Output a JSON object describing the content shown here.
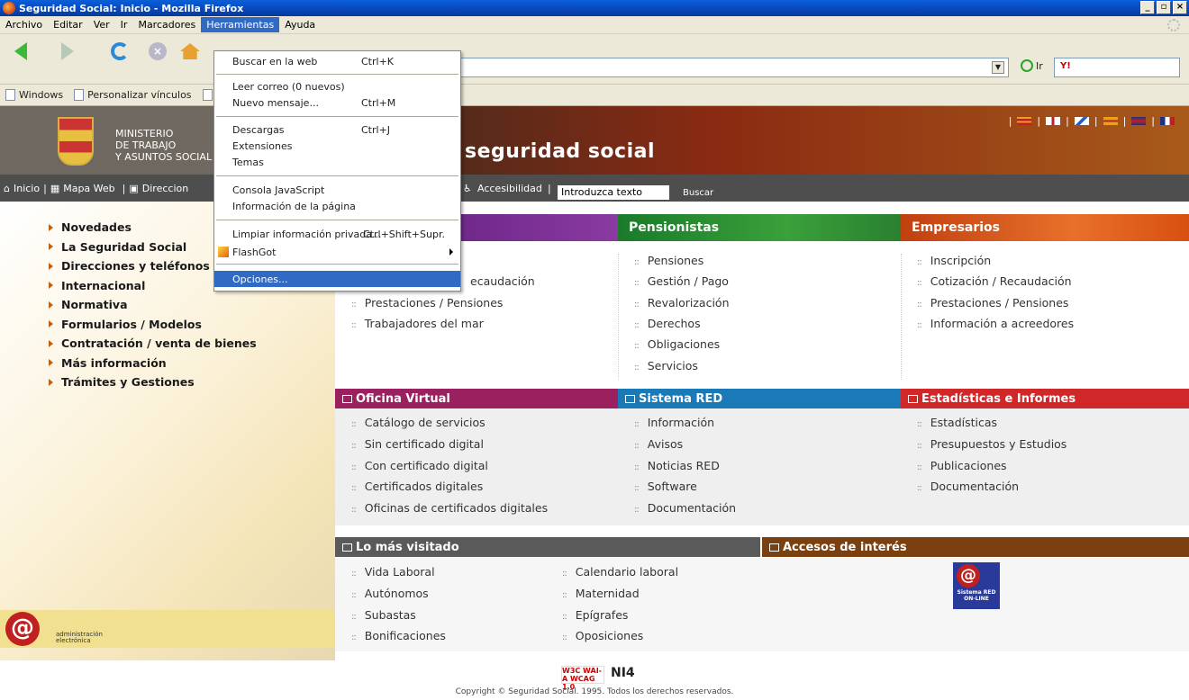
{
  "browser": {
    "title": "Seguridad Social: Inicio - Mozilla Firefox",
    "menu": [
      "Archivo",
      "Editar",
      "Ver",
      "Ir",
      "Marcadores",
      "Herramientas",
      "Ayuda"
    ],
    "go_label": "Ir",
    "search_text": "Y!",
    "bookmarks": [
      "Windows",
      "Personalizar vínculos"
    ],
    "tools_menu": [
      {
        "label": "Buscar en la web",
        "shortcut": "Ctrl+K"
      },
      {
        "label": "Leer correo (0 nuevos)",
        "shortcut": ""
      },
      {
        "label": "Nuevo mensaje...",
        "shortcut": "Ctrl+M"
      },
      {
        "label": "Descargas",
        "shortcut": "Ctrl+J"
      },
      {
        "label": "Extensiones",
        "shortcut": ""
      },
      {
        "label": "Temas",
        "shortcut": ""
      },
      {
        "label": "Consola JavaScript",
        "shortcut": ""
      },
      {
        "label": "Información de la página",
        "shortcut": ""
      },
      {
        "label": "Limpiar información privada...",
        "shortcut": "Ctrl+Shift+Supr."
      },
      {
        "label": "FlashGot",
        "shortcut": ""
      },
      {
        "label": "Opciones...",
        "shortcut": ""
      }
    ]
  },
  "site": {
    "ministry": [
      "MINISTERIO",
      "DE TRABAJO",
      "Y ASUNTOS SOCIAL"
    ],
    "brand": "seguridad social",
    "nav": [
      "Inicio",
      "Mapa Web",
      "Direccion"
    ],
    "accesibilidad": "Accesibilidad",
    "search_placeholder": "Introduzca texto",
    "search_button": "Buscar",
    "left_menu": [
      "Novedades",
      "La Seguridad Social",
      "Direcciones y teléfonos",
      "Internacional",
      "Normativa",
      "Formularios / Modelos",
      "Contratación / venta de bienes",
      "Más información",
      "Trámites y Gestiones"
    ],
    "col1_links": [
      "ecaudación",
      "Prestaciones / Pensiones",
      "Trabajadores del mar"
    ],
    "pensionistas": {
      "title": "Pensionistas",
      "links": [
        "Pensiones",
        "Gestión / Pago",
        "Revalorización",
        "Derechos",
        "Obligaciones",
        "Servicios"
      ]
    },
    "empresarios": {
      "title": "Empresarios",
      "links": [
        "Inscripción",
        "Cotización / Recaudación",
        "Prestaciones / Pensiones",
        "Información a acreedores"
      ]
    },
    "oficina": {
      "title": "Oficina Virtual",
      "links": [
        "Catálogo de servicios",
        "Sin certificado digital",
        "Con certificado digital",
        "Certificados digitales",
        "Oficinas de certificados digitales"
      ]
    },
    "red": {
      "title": "Sistema RED",
      "links": [
        "Información",
        "Avisos",
        "Noticias RED",
        "Software",
        "Documentación"
      ]
    },
    "estadisticas": {
      "title": "Estadísticas e Informes",
      "links": [
        "Estadísticas",
        "Presupuestos y Estudios",
        "Publicaciones",
        "Documentación"
      ]
    },
    "visitado": {
      "title": "Lo más visitado",
      "col1": [
        "Vida Laboral",
        "Autónomos",
        "Subastas",
        "Bonificaciones"
      ],
      "col2": [
        "Calendario laboral",
        "Maternidad",
        "Epígrafes",
        "Oposiciones"
      ]
    },
    "accesos": {
      "title": "Accesos de interés",
      "red_online": "Sistema RED ON-LINE"
    },
    "ae_text": [
      "administración",
      "electrónica"
    ],
    "w3c": "W3C WAI-A WCAG 1.0",
    "ni4": "NI4",
    "copyright": "Copyright © Seguridad Social. 1995. Todos los derechos reservados."
  },
  "colors": {
    "purple": "#7a2a8a",
    "green": "#2a8a2a",
    "orange": "#d85010",
    "magenta": "#9a2060",
    "blue": "#1a7ab8",
    "red": "#d02828",
    "grey": "#5a5a5a",
    "brown": "#7a4010"
  }
}
